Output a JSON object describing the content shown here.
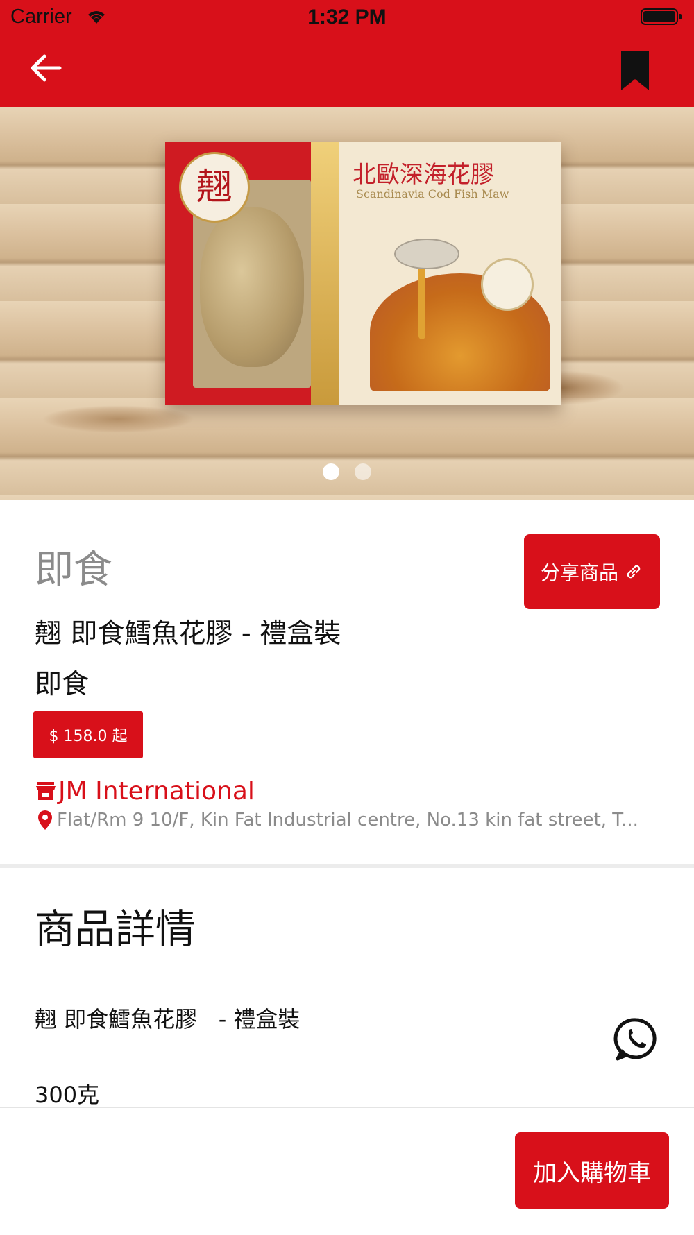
{
  "status_bar": {
    "carrier": "Carrier",
    "time": "1:32 PM"
  },
  "nav": {
    "back_icon": "arrow-left-icon",
    "bookmark_icon": "bookmark-icon"
  },
  "carousel": {
    "page_count": 2,
    "active_index": 0
  },
  "product": {
    "category_heading": "即食",
    "name": "翹 即食鱈魚花膠 - 禮盒裝",
    "category": "即食",
    "price": "$ 158.0 起",
    "share_label": "分享商品"
  },
  "store": {
    "name": "JM International",
    "address": "Flat/Rm 9 10/F, Kin Fat Industrial centre, No.13 kin fat street, T..."
  },
  "details": {
    "heading": "商品詳情",
    "line1": "翹 即食鱈魚花膠   - 禮盒裝",
    "line2": "300克"
  },
  "bottom": {
    "add_to_cart": "加入購物車"
  },
  "colors": {
    "brand_red": "#d8101a",
    "muted_gray": "#8b8b8b"
  }
}
